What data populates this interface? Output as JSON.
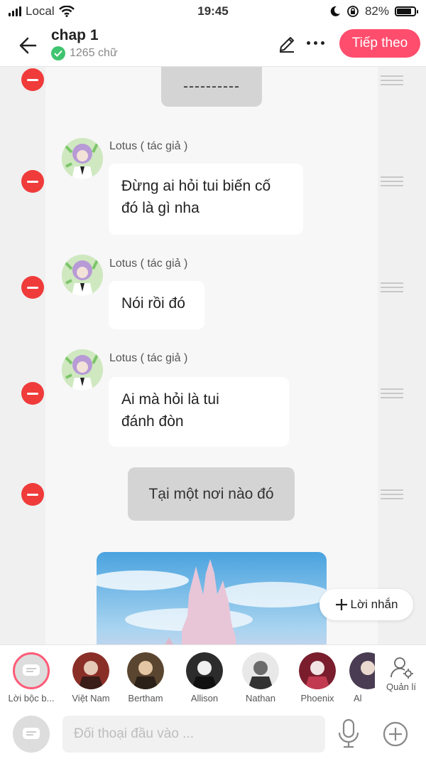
{
  "status_bar": {
    "carrier": "Local",
    "time": "19:45",
    "battery": "82%",
    "battery_level": 0.82
  },
  "header": {
    "title": "chap 1",
    "word_count": "1265 chữ",
    "next_label": "Tiếp theo"
  },
  "messages": [
    {
      "type": "narration",
      "text": "----------"
    },
    {
      "type": "dialog",
      "author": "Lotus ( tác giả )",
      "line1": "Đừng ai hỏi tui biến cố",
      "line2": "đó là gì nha"
    },
    {
      "type": "dialog",
      "author": "Lotus ( tác giả )",
      "line1": "Nói rồi đó"
    },
    {
      "type": "dialog",
      "author": "Lotus ( tác giả )",
      "line1": "Ai mà hỏi là tui",
      "line2": "đánh đòn"
    },
    {
      "type": "narration",
      "text": "Tại một nơi nào đó"
    },
    {
      "type": "image"
    }
  ],
  "add_message_label": "Lời nhắn",
  "characters": [
    {
      "name": "Lời bộc b...",
      "color": "#d6d6d6"
    },
    {
      "name": "Việt Nam",
      "color": "#8a2f28"
    },
    {
      "name": "Bertham",
      "color": "#5a4530"
    },
    {
      "name": "Allison",
      "color": "#2c2c2c"
    },
    {
      "name": "Nathan",
      "color": "#6b6b6b"
    },
    {
      "name": "Phoenix",
      "color": "#7a1e2e"
    },
    {
      "name": "Al",
      "color": "#4a3c52"
    }
  ],
  "manage_label": "Quản lí",
  "input": {
    "placeholder": "Đối thoại đầu vào ..."
  },
  "colors": {
    "accent": "#ff4d6d",
    "delete": "#f03b3b",
    "check": "#3fc46f"
  }
}
